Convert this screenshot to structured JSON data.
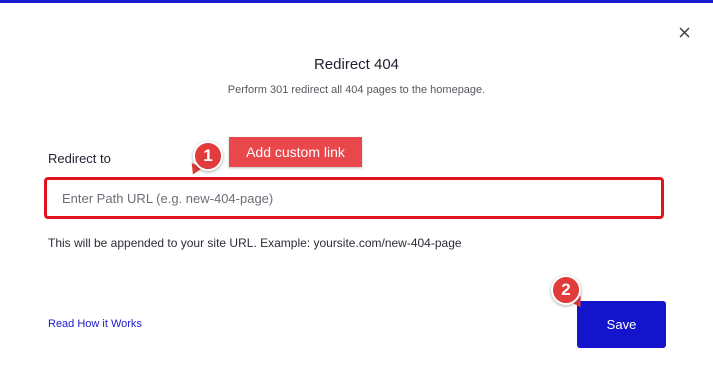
{
  "modal": {
    "title": "Redirect 404",
    "subtitle": "Perform 301 redirect all 404 pages to the homepage.",
    "close_icon": "close-icon",
    "accent_color": "#1a1acc"
  },
  "form": {
    "field_label": "Redirect to",
    "input_value": "",
    "input_placeholder": "Enter Path URL (e.g. new-404-page)",
    "helper_text": "This will be appended to your site URL. Example: yoursite.com/new-404-page",
    "highlight_color": "#e0141e"
  },
  "footer": {
    "read_link_label": "Read How it Works",
    "save_label": "Save"
  },
  "annotations": {
    "step_1": "1",
    "step_2": "2",
    "callout_label": "Add custom link",
    "badge_color": "#e23b3b"
  }
}
